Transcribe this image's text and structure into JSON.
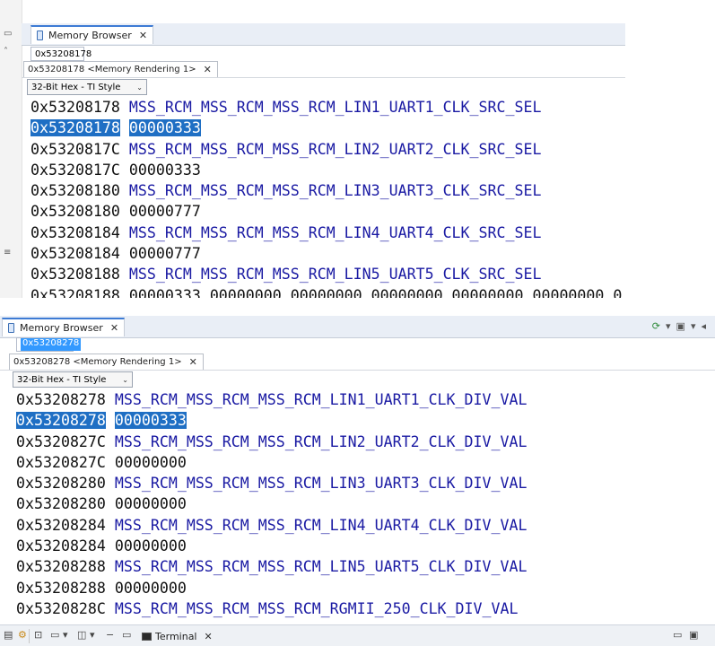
{
  "panel1": {
    "tab_title": "Memory Browser",
    "address_input": "0x53208178",
    "rendering_tab": "0x53208178 <Memory Rendering 1>",
    "format": "32-Bit Hex - TI Style",
    "rows": [
      {
        "addr": "0x53208178",
        "text": "MSS_RCM_MSS_RCM_MSS_RCM_LIN1_UART1_CLK_SRC_SEL",
        "kind": "label"
      },
      {
        "addr": "0x53208178",
        "text": "00000333",
        "kind": "value",
        "highlight": true
      },
      {
        "addr": "0x5320817C",
        "text": "MSS_RCM_MSS_RCM_MSS_RCM_LIN2_UART2_CLK_SRC_SEL",
        "kind": "label"
      },
      {
        "addr": "0x5320817C",
        "text": "00000333",
        "kind": "value"
      },
      {
        "addr": "0x53208180",
        "text": "MSS_RCM_MSS_RCM_MSS_RCM_LIN3_UART3_CLK_SRC_SEL",
        "kind": "label"
      },
      {
        "addr": "0x53208180",
        "text": "00000777",
        "kind": "value"
      },
      {
        "addr": "0x53208184",
        "text": "MSS_RCM_MSS_RCM_MSS_RCM_LIN4_UART4_CLK_SRC_SEL",
        "kind": "label"
      },
      {
        "addr": "0x53208184",
        "text": "00000777",
        "kind": "value"
      },
      {
        "addr": "0x53208188",
        "text": "MSS_RCM_MSS_RCM_MSS_RCM_LIN5_UART5_CLK_SRC_SEL",
        "kind": "label"
      },
      {
        "addr": "0x53208188",
        "text": "00000333 00000000 00000000 00000000 00000000 00000000 0",
        "kind": "value"
      }
    ]
  },
  "panel2": {
    "tab_title": "Memory Browser",
    "address_input": "0x53208278",
    "rendering_tab": "0x53208278 <Memory Rendering 1>",
    "format": "32-Bit Hex - TI Style",
    "rows": [
      {
        "addr": "0x53208278",
        "text": "MSS_RCM_MSS_RCM_MSS_RCM_LIN1_UART1_CLK_DIV_VAL",
        "kind": "label"
      },
      {
        "addr": "0x53208278",
        "text": "00000333",
        "kind": "value",
        "highlight": true
      },
      {
        "addr": "0x5320827C",
        "text": "MSS_RCM_MSS_RCM_MSS_RCM_LIN2_UART2_CLK_DIV_VAL",
        "kind": "label"
      },
      {
        "addr": "0x5320827C",
        "text": "00000000",
        "kind": "value"
      },
      {
        "addr": "0x53208280",
        "text": "MSS_RCM_MSS_RCM_MSS_RCM_LIN3_UART3_CLK_DIV_VAL",
        "kind": "label"
      },
      {
        "addr": "0x53208280",
        "text": "00000000",
        "kind": "value"
      },
      {
        "addr": "0x53208284",
        "text": "MSS_RCM_MSS_RCM_MSS_RCM_LIN4_UART4_CLK_DIV_VAL",
        "kind": "label"
      },
      {
        "addr": "0x53208284",
        "text": "00000000",
        "kind": "value"
      },
      {
        "addr": "0x53208288",
        "text": "MSS_RCM_MSS_RCM_MSS_RCM_LIN5_UART5_CLK_DIV_VAL",
        "kind": "label"
      },
      {
        "addr": "0x53208288",
        "text": "00000000",
        "kind": "value"
      },
      {
        "addr": "0x5320828C",
        "text": "MSS_RCM_MSS_RCM_MSS_RCM_RGMII_250_CLK_DIV_VAL",
        "kind": "label"
      }
    ],
    "toolbar_icons": [
      "refresh-icon",
      "dropdown-icon",
      "new-rendering-icon",
      "dropdown-icon",
      "pin-icon"
    ]
  },
  "bottom_bar": {
    "terminal_tab": "Terminal"
  },
  "colors": {
    "label": "#1a1aa3",
    "highlight": "#1f6fc4",
    "tab_accent": "#3d7bd4"
  }
}
